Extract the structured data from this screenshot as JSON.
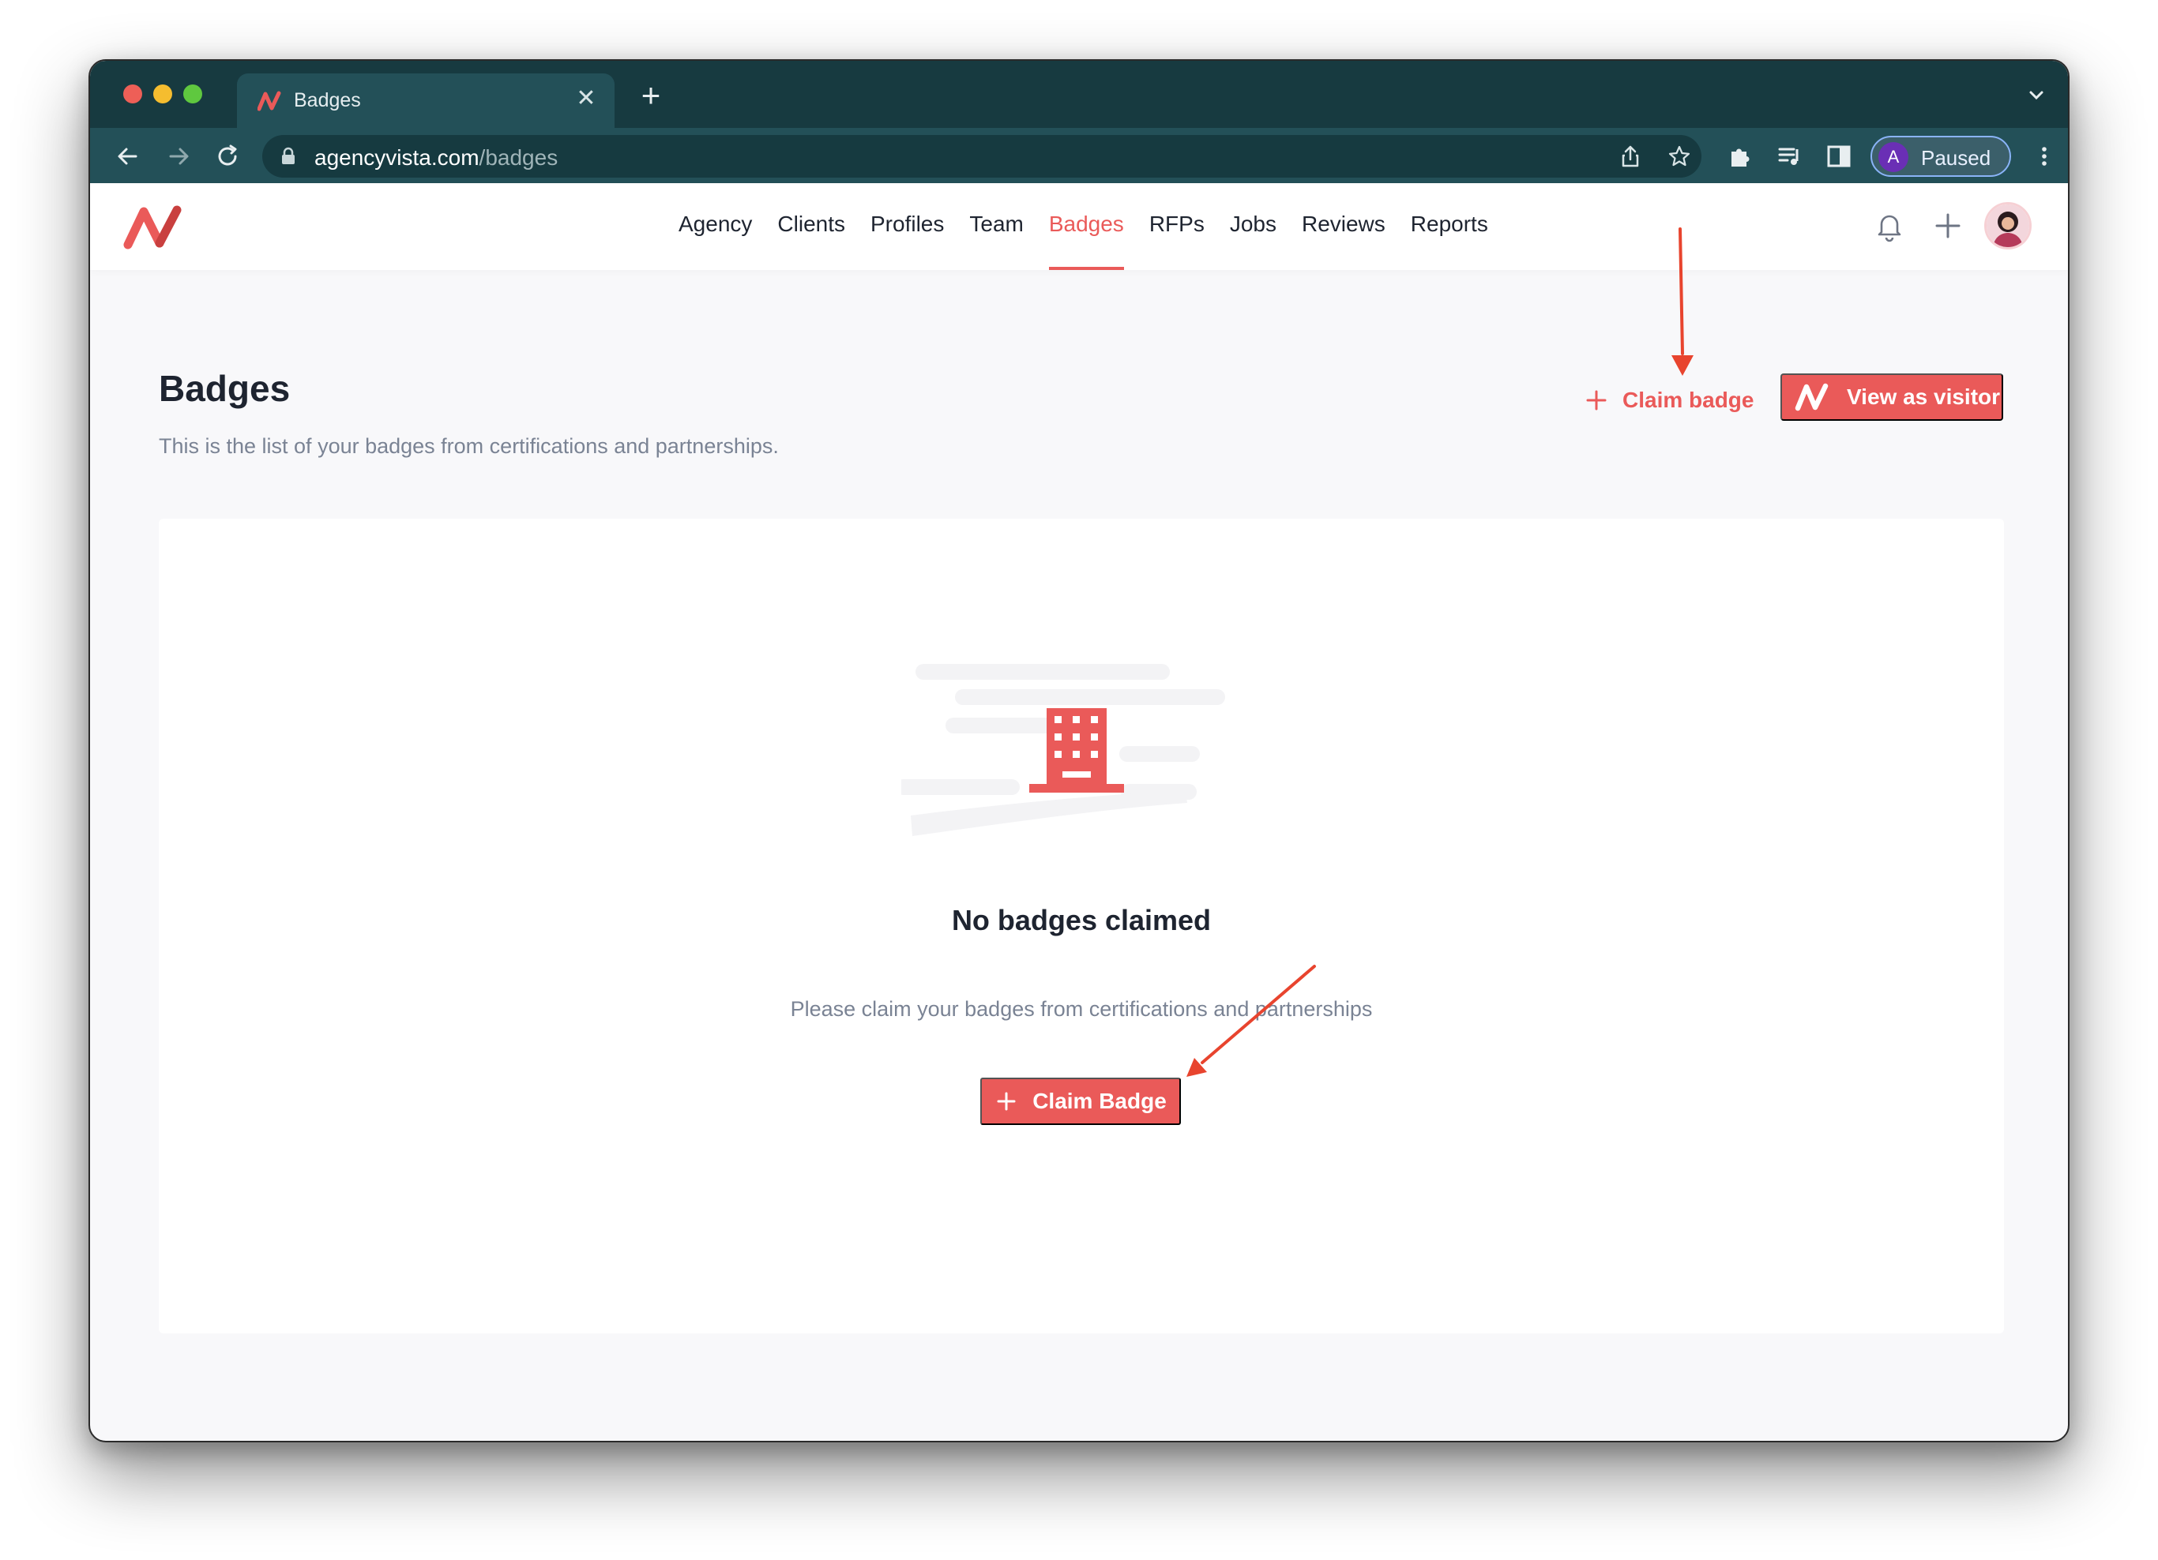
{
  "browser": {
    "tab": {
      "title": "Badges",
      "favicon": "agencyvista-logo-icon",
      "close_icon": "close-icon"
    },
    "new_tab_icon": "plus-icon",
    "url": {
      "domain": "agencyvista.com",
      "path": "/badges"
    },
    "profile": {
      "initial": "A",
      "label": "Paused"
    },
    "icons": [
      "back-arrow-icon",
      "forward-arrow-icon",
      "reload-icon",
      "lock-icon",
      "share-icon",
      "star-icon",
      "extensions-puzzle-icon",
      "media-queue-icon",
      "side-panel-icon",
      "kebab-menu-icon",
      "chevron-down-icon"
    ]
  },
  "header": {
    "nav": [
      "Agency",
      "Clients",
      "Profiles",
      "Team",
      "Badges",
      "RFPs",
      "Jobs",
      "Reviews",
      "Reports"
    ],
    "active_nav": "Badges",
    "icons": [
      "bell-icon",
      "plus-icon",
      "user-avatar"
    ]
  },
  "page": {
    "title": "Badges",
    "subtitle": "This is the list of your badges from certifications and partnerships.",
    "claim_link_label": "Claim badge",
    "visitor_button_label": "View as visitor"
  },
  "empty_state": {
    "illustration": "building-icon",
    "title": "No badges claimed",
    "text": "Please claim your badges from certifications and partnerships",
    "button_label": "Claim Badge"
  },
  "colors": {
    "accent": "#ea5a59",
    "browser_dark": "#173a40",
    "browser_toolbar": "#235058",
    "text_primary": "#1e2430",
    "text_muted": "#7a8394",
    "annotation_arrow": "#e8442e"
  }
}
